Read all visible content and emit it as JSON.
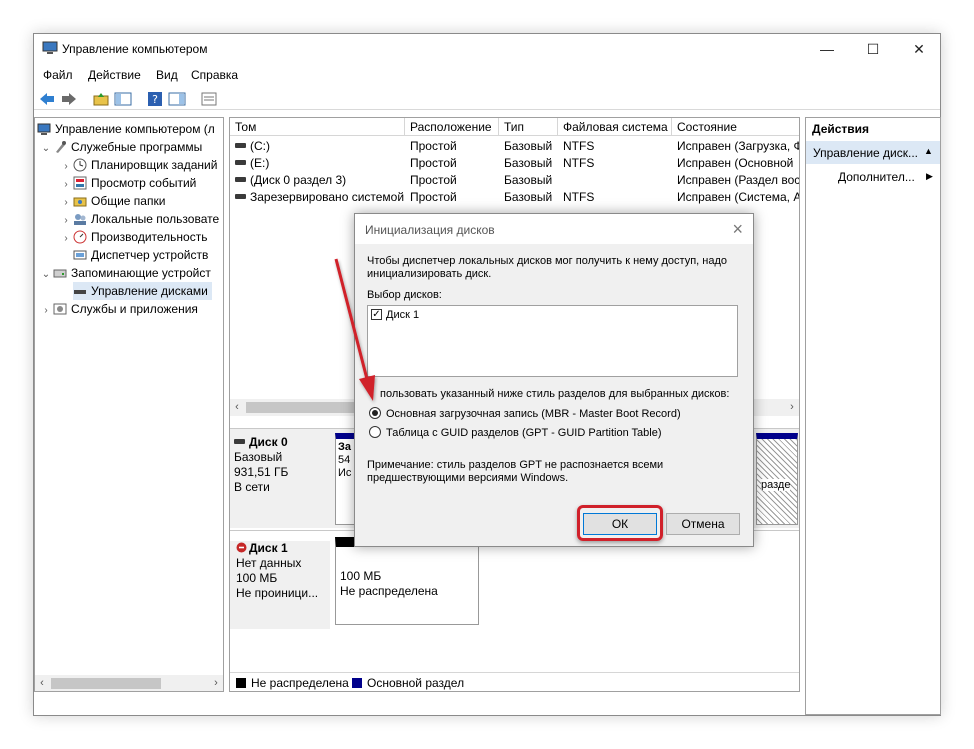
{
  "window": {
    "title": "Управление компьютером",
    "controls": {
      "minimize": "—",
      "maximize": "☐",
      "close": "✕"
    }
  },
  "menu": {
    "file": "Файл",
    "action": "Действие",
    "view": "Вид",
    "help": "Справка"
  },
  "tree": {
    "root": "Управление компьютером (л",
    "items": [
      {
        "label": "Служебные программы",
        "icon": "tools-icon"
      },
      {
        "label": "Планировщик заданий",
        "icon": "clock-icon"
      },
      {
        "label": "Просмотр событий",
        "icon": "event-viewer-icon"
      },
      {
        "label": "Общие папки",
        "icon": "shared-folder-icon"
      },
      {
        "label": "Локальные пользовате",
        "icon": "users-icon"
      },
      {
        "label": "Производительность",
        "icon": "performance-icon"
      },
      {
        "label": "Диспетчер устройств",
        "icon": "device-manager-icon"
      },
      {
        "label": "Запоминающие устройст",
        "icon": "storage-icon"
      },
      {
        "label": "Управление дисками",
        "icon": "disk-icon"
      },
      {
        "label": "Службы и приложения",
        "icon": "services-icon"
      }
    ]
  },
  "volumes": {
    "columns": [
      "Том",
      "Расположение",
      "Тип",
      "Файловая система",
      "Состояние"
    ],
    "rows": [
      [
        "(C:)",
        "Простой",
        "Базовый",
        "NTFS",
        "Исправен (Загрузка, Ф"
      ],
      [
        "(E:)",
        "Простой",
        "Базовый",
        "NTFS",
        "Исправен (Основной"
      ],
      [
        "(Диск 0 раздел 3)",
        "Простой",
        "Базовый",
        "",
        "Исправен (Раздел вос"
      ],
      [
        "Зарезервировано системой",
        "Простой",
        "Базовый",
        "NTFS",
        "Исправен (Система, А"
      ]
    ]
  },
  "disks": {
    "disk0": {
      "name": "Диск 0",
      "type": "Базовый",
      "size": "931,51 ГБ",
      "status": "В сети",
      "partial1": "За",
      "partial2": "54",
      "partial3": "Ис",
      "right_partial": "разде"
    },
    "disk1": {
      "name": "Диск 1",
      "type": "Нет данных",
      "size": "100 МБ",
      "status": "Не проиници...",
      "part_size": "100 МБ",
      "part_status": "Не распределена"
    }
  },
  "legend": {
    "unallocated": "Не распределена",
    "primary": "Основной раздел",
    "colors": {
      "unallocated": "#000000",
      "primary": "#00008b"
    }
  },
  "actions": {
    "header": "Действия",
    "selected": "Управление диск...",
    "more": "Дополнител..."
  },
  "dialog": {
    "title": "Инициализация дисков",
    "intro": "Чтобы диспетчер локальных дисков мог получить к нему доступ, надо инициализировать диск.",
    "select_label": "Выбор дисков:",
    "disk_item": "Диск 1",
    "style_label": "пользовать указанный ниже стиль разделов для выбранных дисков:",
    "mbr": "Основная загрузочная запись (MBR - Master Boot Record)",
    "gpt": "Таблица с GUID разделов (GPT - GUID Partition Table)",
    "note": "Примечание: стиль разделов GPT не распознается всеми предшествующими версиями Windows.",
    "ok": "ОК",
    "cancel": "Отмена"
  },
  "accent": {
    "annotation": "#d0202a",
    "selection": "#dce8f5"
  }
}
